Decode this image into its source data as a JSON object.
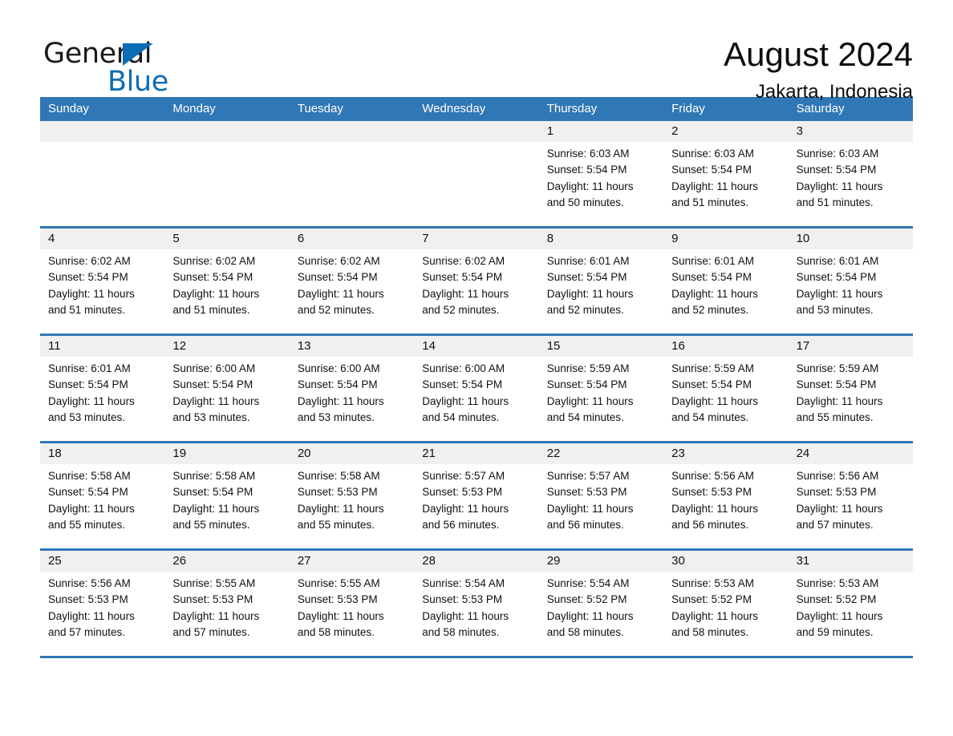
{
  "logo": {
    "word_one": "General",
    "word_two": "Blue",
    "triangle_color": "#0b6cb5"
  },
  "header": {
    "title": "August 2024",
    "subtitle": "Jakarta, Indonesia"
  },
  "theme": {
    "header_blue": "#3077b5",
    "day_band_gray": "#f0f0f0",
    "row_border_blue": "#3077b5"
  },
  "weekdays": [
    "Sunday",
    "Monday",
    "Tuesday",
    "Wednesday",
    "Thursday",
    "Friday",
    "Saturday"
  ],
  "weeks": [
    [
      {
        "date": "",
        "sunrise": "",
        "sunset": "",
        "daylight_line1": "",
        "daylight_line2": ""
      },
      {
        "date": "",
        "sunrise": "",
        "sunset": "",
        "daylight_line1": "",
        "daylight_line2": ""
      },
      {
        "date": "",
        "sunrise": "",
        "sunset": "",
        "daylight_line1": "",
        "daylight_line2": ""
      },
      {
        "date": "",
        "sunrise": "",
        "sunset": "",
        "daylight_line1": "",
        "daylight_line2": ""
      },
      {
        "date": "1",
        "sunrise": "Sunrise: 6:03 AM",
        "sunset": "Sunset: 5:54 PM",
        "daylight_line1": "Daylight: 11 hours",
        "daylight_line2": "and 50 minutes."
      },
      {
        "date": "2",
        "sunrise": "Sunrise: 6:03 AM",
        "sunset": "Sunset: 5:54 PM",
        "daylight_line1": "Daylight: 11 hours",
        "daylight_line2": "and 51 minutes."
      },
      {
        "date": "3",
        "sunrise": "Sunrise: 6:03 AM",
        "sunset": "Sunset: 5:54 PM",
        "daylight_line1": "Daylight: 11 hours",
        "daylight_line2": "and 51 minutes."
      }
    ],
    [
      {
        "date": "4",
        "sunrise": "Sunrise: 6:02 AM",
        "sunset": "Sunset: 5:54 PM",
        "daylight_line1": "Daylight: 11 hours",
        "daylight_line2": "and 51 minutes."
      },
      {
        "date": "5",
        "sunrise": "Sunrise: 6:02 AM",
        "sunset": "Sunset: 5:54 PM",
        "daylight_line1": "Daylight: 11 hours",
        "daylight_line2": "and 51 minutes."
      },
      {
        "date": "6",
        "sunrise": "Sunrise: 6:02 AM",
        "sunset": "Sunset: 5:54 PM",
        "daylight_line1": "Daylight: 11 hours",
        "daylight_line2": "and 52 minutes."
      },
      {
        "date": "7",
        "sunrise": "Sunrise: 6:02 AM",
        "sunset": "Sunset: 5:54 PM",
        "daylight_line1": "Daylight: 11 hours",
        "daylight_line2": "and 52 minutes."
      },
      {
        "date": "8",
        "sunrise": "Sunrise: 6:01 AM",
        "sunset": "Sunset: 5:54 PM",
        "daylight_line1": "Daylight: 11 hours",
        "daylight_line2": "and 52 minutes."
      },
      {
        "date": "9",
        "sunrise": "Sunrise: 6:01 AM",
        "sunset": "Sunset: 5:54 PM",
        "daylight_line1": "Daylight: 11 hours",
        "daylight_line2": "and 52 minutes."
      },
      {
        "date": "10",
        "sunrise": "Sunrise: 6:01 AM",
        "sunset": "Sunset: 5:54 PM",
        "daylight_line1": "Daylight: 11 hours",
        "daylight_line2": "and 53 minutes."
      }
    ],
    [
      {
        "date": "11",
        "sunrise": "Sunrise: 6:01 AM",
        "sunset": "Sunset: 5:54 PM",
        "daylight_line1": "Daylight: 11 hours",
        "daylight_line2": "and 53 minutes."
      },
      {
        "date": "12",
        "sunrise": "Sunrise: 6:00 AM",
        "sunset": "Sunset: 5:54 PM",
        "daylight_line1": "Daylight: 11 hours",
        "daylight_line2": "and 53 minutes."
      },
      {
        "date": "13",
        "sunrise": "Sunrise: 6:00 AM",
        "sunset": "Sunset: 5:54 PM",
        "daylight_line1": "Daylight: 11 hours",
        "daylight_line2": "and 53 minutes."
      },
      {
        "date": "14",
        "sunrise": "Sunrise: 6:00 AM",
        "sunset": "Sunset: 5:54 PM",
        "daylight_line1": "Daylight: 11 hours",
        "daylight_line2": "and 54 minutes."
      },
      {
        "date": "15",
        "sunrise": "Sunrise: 5:59 AM",
        "sunset": "Sunset: 5:54 PM",
        "daylight_line1": "Daylight: 11 hours",
        "daylight_line2": "and 54 minutes."
      },
      {
        "date": "16",
        "sunrise": "Sunrise: 5:59 AM",
        "sunset": "Sunset: 5:54 PM",
        "daylight_line1": "Daylight: 11 hours",
        "daylight_line2": "and 54 minutes."
      },
      {
        "date": "17",
        "sunrise": "Sunrise: 5:59 AM",
        "sunset": "Sunset: 5:54 PM",
        "daylight_line1": "Daylight: 11 hours",
        "daylight_line2": "and 55 minutes."
      }
    ],
    [
      {
        "date": "18",
        "sunrise": "Sunrise: 5:58 AM",
        "sunset": "Sunset: 5:54 PM",
        "daylight_line1": "Daylight: 11 hours",
        "daylight_line2": "and 55 minutes."
      },
      {
        "date": "19",
        "sunrise": "Sunrise: 5:58 AM",
        "sunset": "Sunset: 5:54 PM",
        "daylight_line1": "Daylight: 11 hours",
        "daylight_line2": "and 55 minutes."
      },
      {
        "date": "20",
        "sunrise": "Sunrise: 5:58 AM",
        "sunset": "Sunset: 5:53 PM",
        "daylight_line1": "Daylight: 11 hours",
        "daylight_line2": "and 55 minutes."
      },
      {
        "date": "21",
        "sunrise": "Sunrise: 5:57 AM",
        "sunset": "Sunset: 5:53 PM",
        "daylight_line1": "Daylight: 11 hours",
        "daylight_line2": "and 56 minutes."
      },
      {
        "date": "22",
        "sunrise": "Sunrise: 5:57 AM",
        "sunset": "Sunset: 5:53 PM",
        "daylight_line1": "Daylight: 11 hours",
        "daylight_line2": "and 56 minutes."
      },
      {
        "date": "23",
        "sunrise": "Sunrise: 5:56 AM",
        "sunset": "Sunset: 5:53 PM",
        "daylight_line1": "Daylight: 11 hours",
        "daylight_line2": "and 56 minutes."
      },
      {
        "date": "24",
        "sunrise": "Sunrise: 5:56 AM",
        "sunset": "Sunset: 5:53 PM",
        "daylight_line1": "Daylight: 11 hours",
        "daylight_line2": "and 57 minutes."
      }
    ],
    [
      {
        "date": "25",
        "sunrise": "Sunrise: 5:56 AM",
        "sunset": "Sunset: 5:53 PM",
        "daylight_line1": "Daylight: 11 hours",
        "daylight_line2": "and 57 minutes."
      },
      {
        "date": "26",
        "sunrise": "Sunrise: 5:55 AM",
        "sunset": "Sunset: 5:53 PM",
        "daylight_line1": "Daylight: 11 hours",
        "daylight_line2": "and 57 minutes."
      },
      {
        "date": "27",
        "sunrise": "Sunrise: 5:55 AM",
        "sunset": "Sunset: 5:53 PM",
        "daylight_line1": "Daylight: 11 hours",
        "daylight_line2": "and 58 minutes."
      },
      {
        "date": "28",
        "sunrise": "Sunrise: 5:54 AM",
        "sunset": "Sunset: 5:53 PM",
        "daylight_line1": "Daylight: 11 hours",
        "daylight_line2": "and 58 minutes."
      },
      {
        "date": "29",
        "sunrise": "Sunrise: 5:54 AM",
        "sunset": "Sunset: 5:52 PM",
        "daylight_line1": "Daylight: 11 hours",
        "daylight_line2": "and 58 minutes."
      },
      {
        "date": "30",
        "sunrise": "Sunrise: 5:53 AM",
        "sunset": "Sunset: 5:52 PM",
        "daylight_line1": "Daylight: 11 hours",
        "daylight_line2": "and 58 minutes."
      },
      {
        "date": "31",
        "sunrise": "Sunrise: 5:53 AM",
        "sunset": "Sunset: 5:52 PM",
        "daylight_line1": "Daylight: 11 hours",
        "daylight_line2": "and 59 minutes."
      }
    ]
  ]
}
